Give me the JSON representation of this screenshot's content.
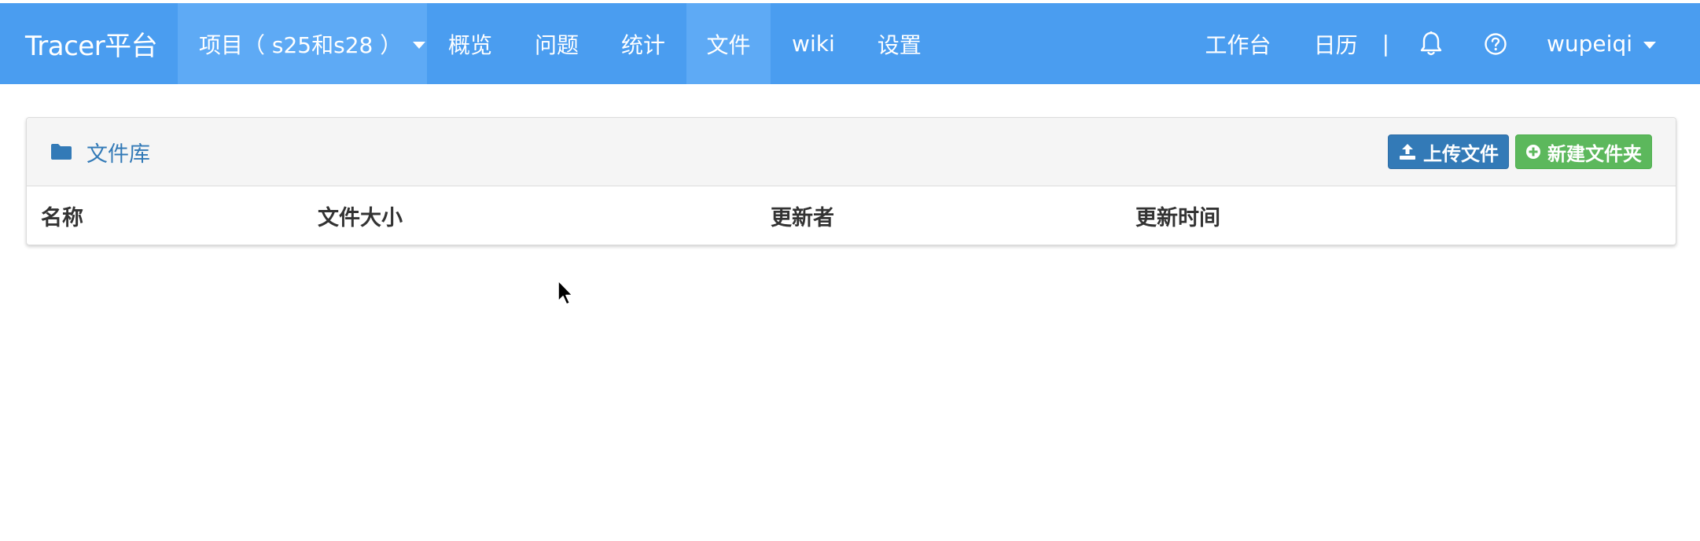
{
  "navbar": {
    "brand": "Tracer平台",
    "project_label": "项目（ s25和s28 ）",
    "items": [
      {
        "label": "概览"
      },
      {
        "label": "问题"
      },
      {
        "label": "统计"
      },
      {
        "label": "文件"
      },
      {
        "label": "wiki"
      },
      {
        "label": "设置"
      }
    ],
    "active_item": "文件",
    "right_items": [
      {
        "label": "工作台"
      },
      {
        "label": "日历"
      }
    ],
    "separator": "|",
    "icons": [
      "bell-icon",
      "question-circle-icon"
    ],
    "user": "wupeiqi",
    "colors": {
      "bar": "#4a9df0",
      "active": "#5eaaf5"
    }
  },
  "panel": {
    "title": "文件库",
    "upload_button": "上传文件",
    "new_folder_button": "新建文件夹",
    "columns": [
      "名称",
      "文件大小",
      "更新者",
      "更新时间"
    ],
    "rows": []
  },
  "colors": {
    "primary": "#337ab7",
    "success": "#5cb85c"
  }
}
